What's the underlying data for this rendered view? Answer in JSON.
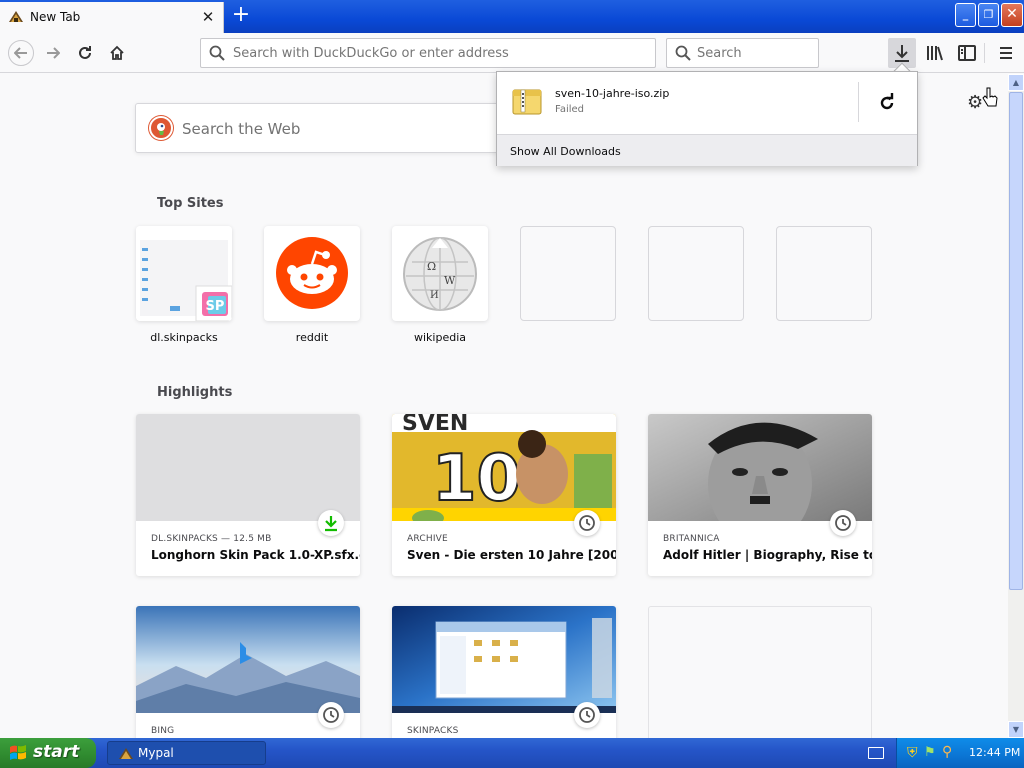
{
  "tab": {
    "title": "New Tab",
    "close": "✕",
    "new_tab": "+"
  },
  "window_controls": {
    "minimize": "_",
    "restore": "❐",
    "close": "✕"
  },
  "toolbar": {
    "url_placeholder": "Search with DuckDuckGo or enter address",
    "search_placeholder": "Search"
  },
  "content": {
    "web_search_placeholder": "Search the Web",
    "top_sites_title": "Top Sites",
    "highlights_title": "Highlights",
    "top_sites": [
      {
        "label": "dl.skinpacks"
      },
      {
        "label": "reddit"
      },
      {
        "label": "wikipedia"
      },
      {
        "label": ""
      },
      {
        "label": ""
      },
      {
        "label": ""
      }
    ],
    "highlights": [
      {
        "source": "DL.SKINPACKS — 12.5 MB",
        "title": "Longhorn Skin Pack 1.0-XP.sfx.e…",
        "badge": "download"
      },
      {
        "source": "ARCHIVE",
        "title": "Sven - Die ersten 10 Jahre [200…",
        "badge": "history"
      },
      {
        "source": "BRITANNICA",
        "title": "Adolf Hitler | Biography, Rise to …",
        "badge": "history"
      },
      {
        "source": "BING",
        "title": "",
        "badge": "history"
      },
      {
        "source": "SKINPACKS",
        "title": "",
        "badge": "history"
      },
      {
        "source": "",
        "title": "",
        "badge": ""
      }
    ]
  },
  "downloads_panel": {
    "file_name": "sven-10-jahre-iso.zip",
    "status": "Failed",
    "show_all": "Show All Downloads"
  },
  "taskbar": {
    "start_label": "start",
    "task_item": "Mypal",
    "clock": "12:44 PM"
  },
  "colors": {
    "titlebar": "#0a49d6",
    "start_green": "#2f8a2f",
    "tray_blue": "#0b75d4",
    "reddit_orange": "#ff4500",
    "duckduckgo": "#de5833",
    "download_green": "#12bc00"
  }
}
